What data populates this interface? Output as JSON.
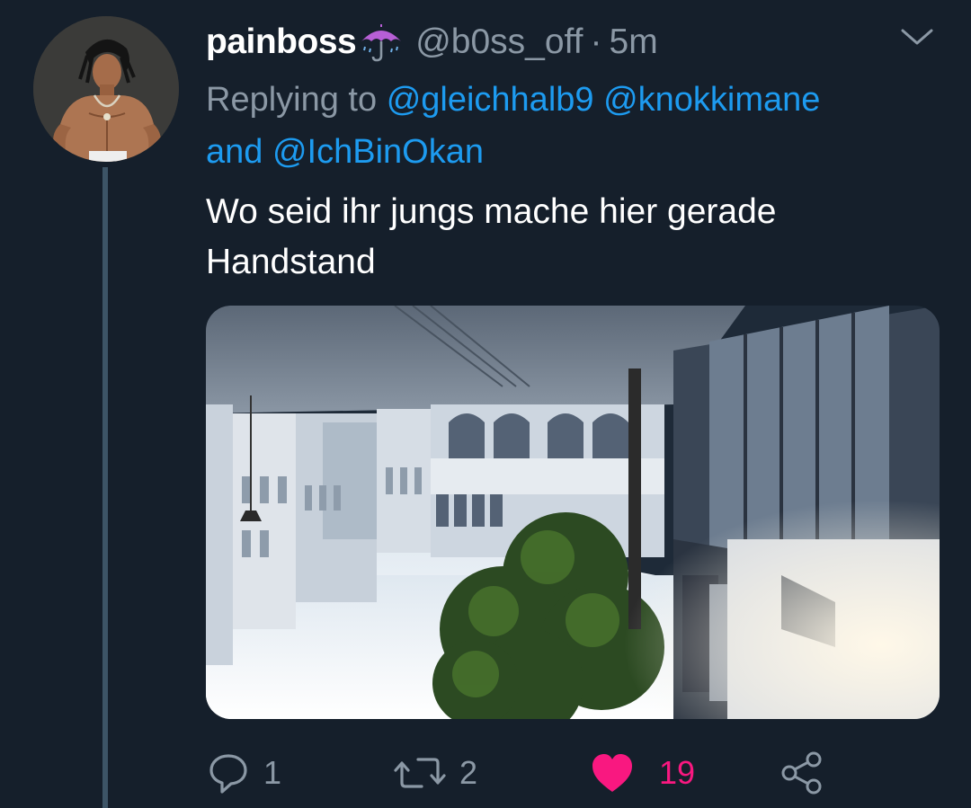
{
  "tweet": {
    "display_name": "painboss",
    "name_emoji": "umbrella-with-rain-icon",
    "handle": "@b0ss_off",
    "separator": "·",
    "time": "5m",
    "replying_prefix": "Replying to",
    "replying_mention_1": "@gleichhalb9",
    "replying_mention_2": "@knokkimane",
    "replying_and": "and",
    "replying_mention_3": "@IchBinOkan",
    "text_line_1": "Wo seid ihr jungs mache hier gerade",
    "text_line_2": "Handstand",
    "media_description": "upside-down-street-photo"
  },
  "actions": {
    "reply_count": "1",
    "retweet_count": "2",
    "like_count": "19",
    "liked": true
  },
  "colors": {
    "background": "#151f2b",
    "secondary_text": "#8b98a5",
    "link": "#1d9bf0",
    "like": "#f91880",
    "thread_line": "#3d5466"
  }
}
